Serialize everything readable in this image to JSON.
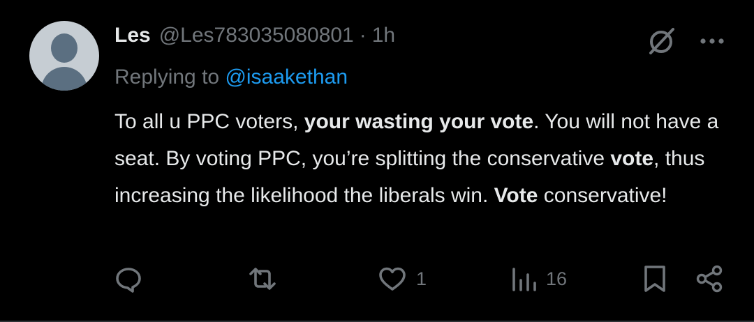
{
  "tweet": {
    "author_name": "Les",
    "author_handle": "@Les783035080801",
    "separator": "·",
    "time": "1h",
    "replying_prefix": "Replying to ",
    "replying_to": "@isaakethan",
    "body": [
      {
        "text": "To all u PPC voters, ",
        "bold": false
      },
      {
        "text": "your wasting your vote",
        "bold": true
      },
      {
        "text": ". You will not have a seat. By voting PPC, you’re splitting the conservative ",
        "bold": false
      },
      {
        "text": "vote",
        "bold": true
      },
      {
        "text": ", thus increasing the likelihood the liberals win. ",
        "bold": false
      },
      {
        "text": "Vote",
        "bold": true
      },
      {
        "text": " conservative!",
        "bold": false
      }
    ]
  },
  "actions": {
    "reply_icon": "reply-icon",
    "retweet_icon": "retweet-icon",
    "like_icon": "heart-icon",
    "like_count": "1",
    "views_icon": "views-icon",
    "views_count": "16",
    "bookmark_icon": "bookmark-icon",
    "share_icon": "share-icon"
  },
  "header_icons": [
    "grok-icon",
    "more-icon"
  ],
  "colors": {
    "background": "#000000",
    "text": "#e7e9ea",
    "muted": "#71767b",
    "link": "#1d9bf0"
  }
}
